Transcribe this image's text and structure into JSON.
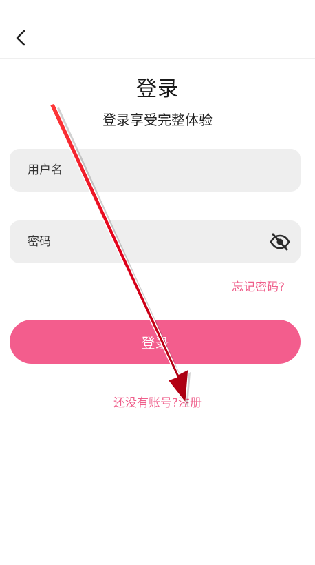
{
  "header": {
    "back_icon": "chevron-left-icon"
  },
  "login": {
    "title": "登录",
    "subtitle": "登录享受完整体验",
    "username_placeholder": "用户名",
    "password_placeholder": "密码",
    "password_toggle_icon": "eye-off-icon",
    "forgot_label": "忘记密码?",
    "submit_label": "登录",
    "no_account_label": "还没有账号?",
    "register_label": "注册"
  },
  "colors": {
    "accent": "#f35d8d",
    "link": "#ef5f8b",
    "field_bg": "#eeeeee",
    "annotation_arrow": "#e2001a"
  }
}
